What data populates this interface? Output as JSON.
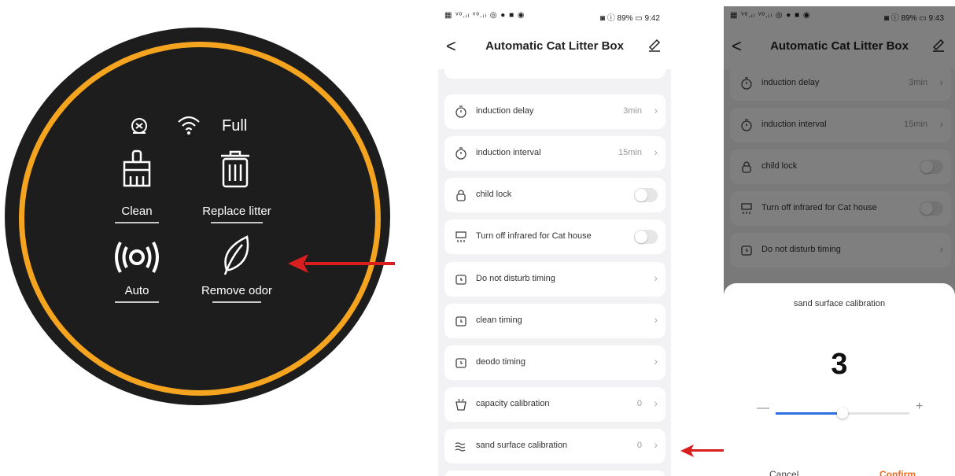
{
  "device": {
    "status_full": "Full",
    "buttons": [
      {
        "label": "Clean",
        "icon": "broom-icon"
      },
      {
        "label": "Replace litter",
        "icon": "trash-icon"
      },
      {
        "label": "Auto",
        "icon": "broadcast-icon"
      },
      {
        "label": "Remove odor",
        "icon": "leaf-icon"
      }
    ],
    "status_icons": [
      "cat-head-icon",
      "wifi-icon"
    ],
    "colors": {
      "ring": "#f4a41f",
      "disc": "#1d1d1d",
      "arrow": "#d81e1e"
    }
  },
  "phone1": {
    "status_bar": {
      "left": "▦ ᵛᵒ.ᵢₗ ᵛᵒ.ᵢₗ ◎ ● ■ ◉",
      "right": "◙ ⓘ 89% ▭ 9:42"
    },
    "nav": {
      "back": "<",
      "title": "Automatic Cat Litter Box",
      "edit": "edit-icon"
    },
    "items": [
      {
        "label": "induction delay",
        "value": "3min",
        "icon": "timer-icon",
        "control": "chevron"
      },
      {
        "label": "induction interval",
        "value": "15min",
        "icon": "timer-icon",
        "control": "chevron"
      },
      {
        "label": "child lock",
        "value": "",
        "icon": "lock-icon",
        "control": "toggle"
      },
      {
        "label": "Turn off infrared for Cat house",
        "value": "",
        "icon": "infrared-icon",
        "control": "toggle"
      },
      {
        "label": "Do not disturb timing",
        "value": "",
        "icon": "alarm-icon",
        "control": "chevron"
      },
      {
        "label": "clean timing",
        "value": "",
        "icon": "alarm-icon",
        "control": "chevron"
      },
      {
        "label": "deodo timing",
        "value": "",
        "icon": "alarm-icon",
        "control": "chevron"
      },
      {
        "label": "capacity calibration",
        "value": "0",
        "icon": "bin-icon",
        "control": "chevron"
      },
      {
        "label": "sand surface calibration",
        "value": "0",
        "icon": "waves-icon",
        "control": "chevron"
      }
    ]
  },
  "phone2": {
    "status_bar": {
      "left": "▦ ᵛᵒ.ᵢₗ ᵛᵒ.ᵢₗ ◎ ● ■ ◉",
      "right": "◙ ⓘ 89% ▭ 9:43"
    },
    "nav": {
      "back": "<",
      "title": "Automatic Cat Litter Box"
    },
    "items": [
      {
        "label": "induction delay",
        "value": "3min"
      },
      {
        "label": "induction interval",
        "value": "15min"
      },
      {
        "label": "child lock",
        "value": ""
      },
      {
        "label": "Turn off infrared for Cat house",
        "value": ""
      },
      {
        "label": "Do not disturb timing",
        "value": ""
      }
    ],
    "dialog": {
      "title": "sand surface calibration",
      "value": "3",
      "minus": "—",
      "plus": "+",
      "slider_fraction": 0.5,
      "cancel": "Cancel",
      "confirm": "Confirm",
      "accent": "#ef6a1a",
      "slider_color": "#2f6fe0"
    }
  }
}
